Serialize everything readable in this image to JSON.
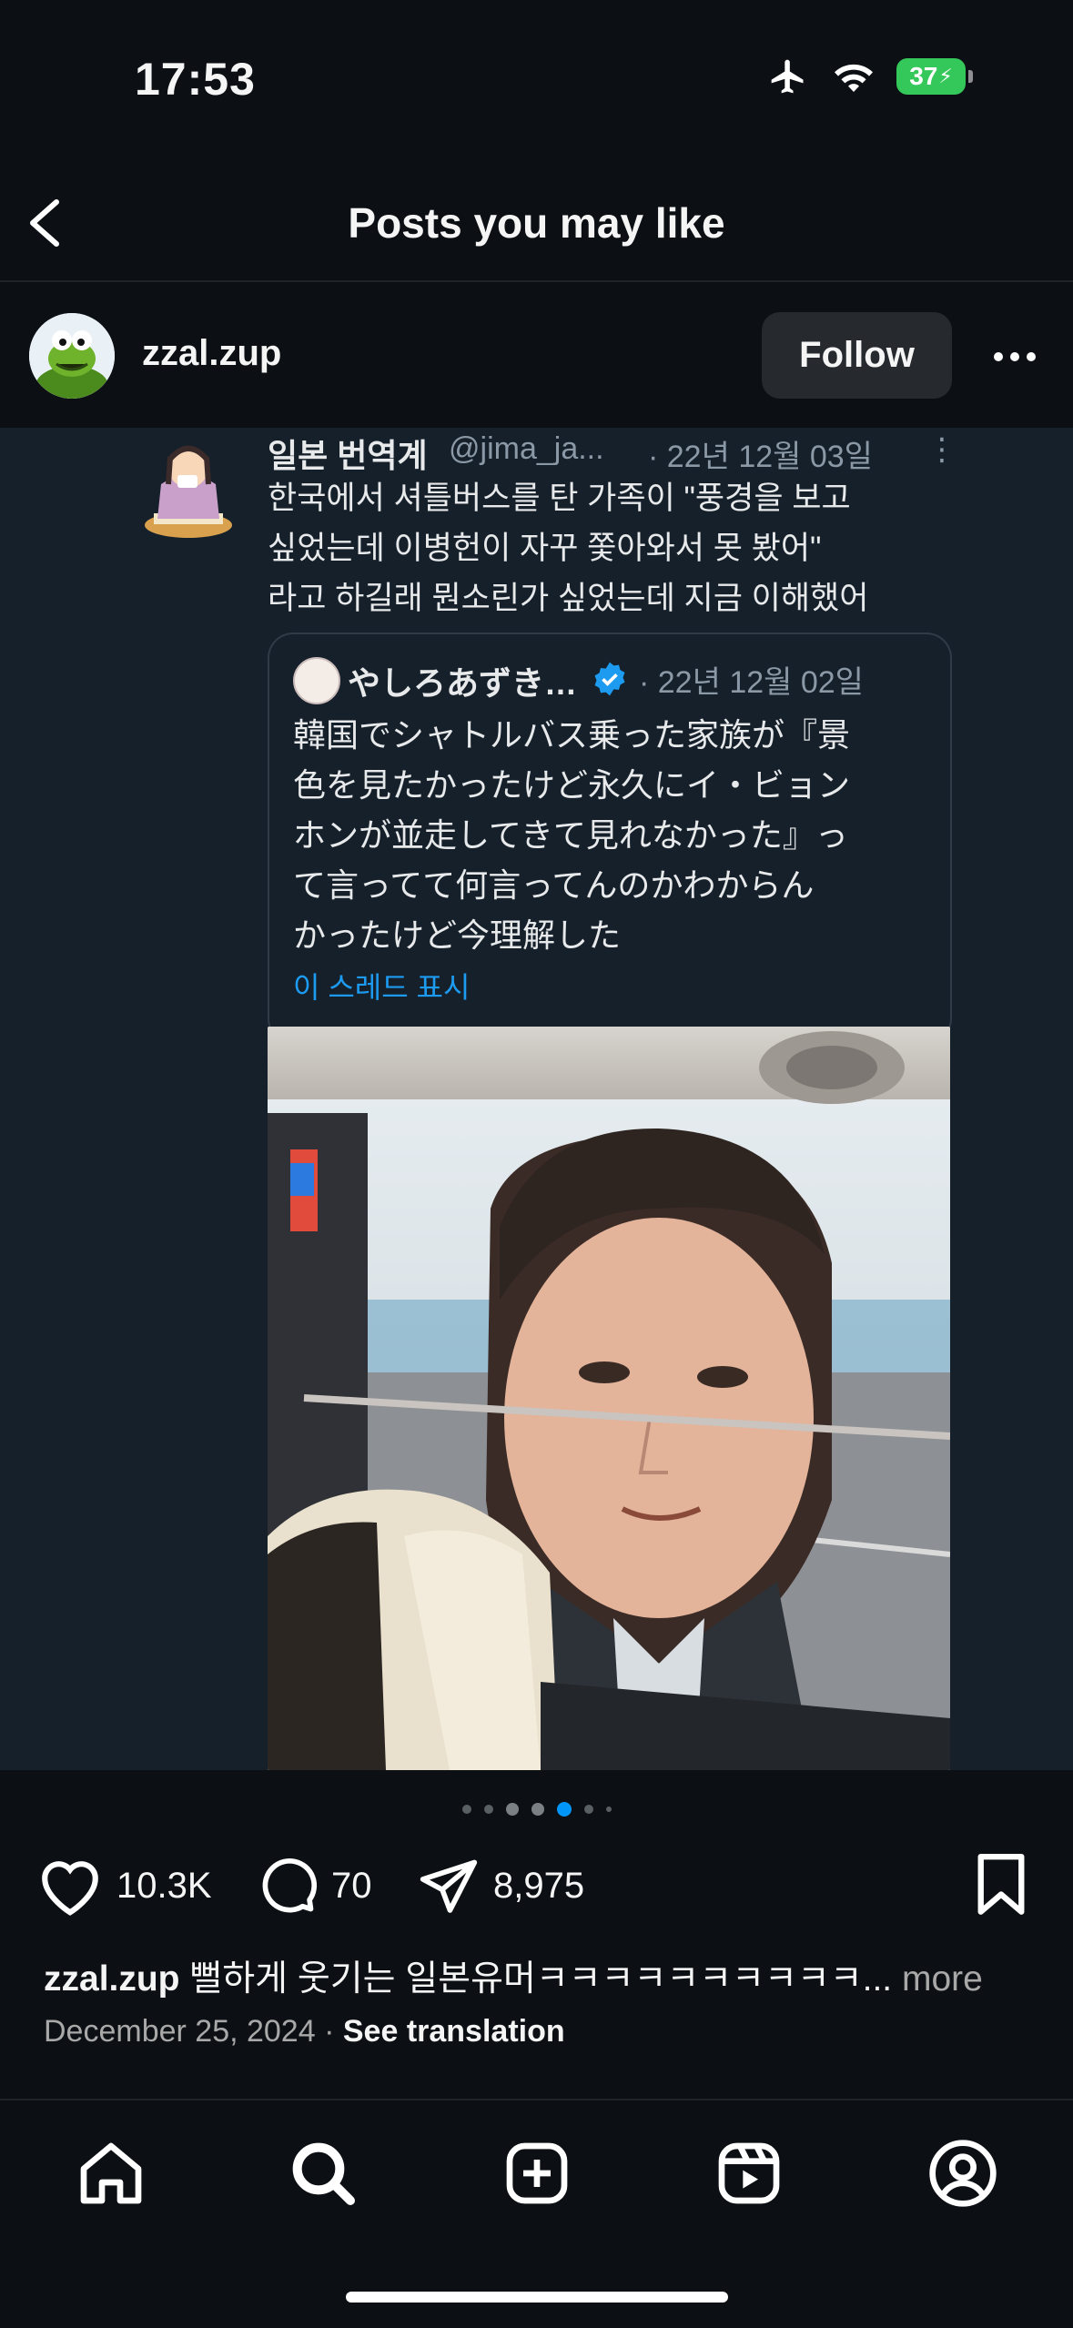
{
  "status_bar": {
    "time": "17:53",
    "battery": "37"
  },
  "header": {
    "title": "Posts you may like"
  },
  "post": {
    "username": "zzal.zup",
    "follow_label": "Follow",
    "likes": "10.3K",
    "comments": "70",
    "shares": "8,975",
    "caption_user": "zzal.zup",
    "caption_text": "뻘하게 웃기는 일본유머ㅋㅋㅋㅋㅋㅋㅋㅋㅋㅋ...",
    "caption_more": "more",
    "date": "December 25, 2024",
    "see_translation": "See translation"
  },
  "tweet": {
    "name": "일본 번역계",
    "handle": "@jima_ja...",
    "date": "· 22년 12월 03일",
    "kebab": "⋮",
    "lines": [
      "한국에서 셔틀버스를 탄 가족이 \"풍경을 보고",
      "싶었는데 이병헌이 자꾸 쫓아와서 못 봤어\"",
      "라고 하길래 뭔소린가 싶었는데 지금 이해했어"
    ],
    "quote": {
      "name": "やしろあずき…",
      "date": "· 22년 12월 02일",
      "lines": [
        "韓国でシャトルバス乗った家族が『景",
        "色を見たかったけど永久にイ・ビョン",
        "ホンが並走してきて見れなかった』っ",
        "て言ってて何言ってんのかわからん",
        "かったけど今理解した"
      ],
      "thread_link": "이 스레드 표시"
    }
  },
  "carousel": {
    "count": 7,
    "active": 4
  },
  "colors": {
    "accent": "#0095f6",
    "background": "#0c1014",
    "tweet_bg": "#15202b",
    "link": "#1d9bf0"
  }
}
